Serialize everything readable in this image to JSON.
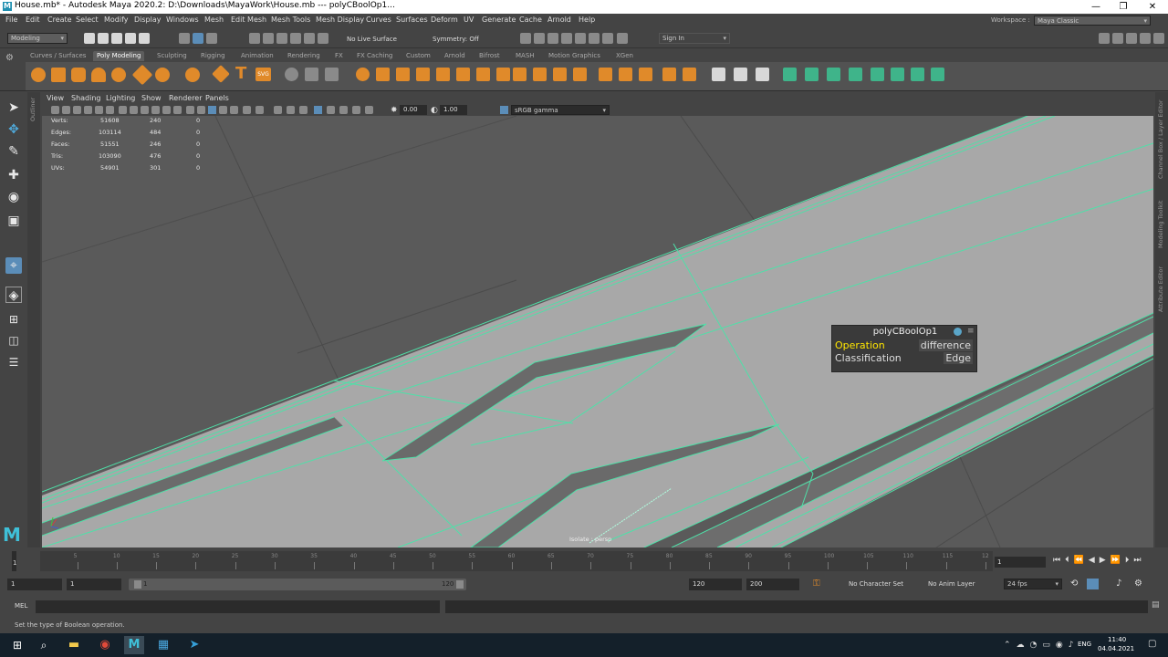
{
  "window": {
    "title": "House.mb* - Autodesk Maya 2020.2: D:\\Downloads\\MayaWork\\House.mb   ---   polyCBoolOp1...",
    "minimize": "—",
    "maximize": "❐",
    "close": "✕"
  },
  "menubar": {
    "items": [
      "File",
      "Edit",
      "Create",
      "Select",
      "Modify",
      "Display",
      "Windows",
      "Mesh",
      "Edit Mesh",
      "Mesh Tools",
      "Mesh Display",
      "Curves",
      "Surfaces",
      "Deform",
      "UV",
      "Generate",
      "Cache",
      "Arnold",
      "Help"
    ],
    "workspace_label": "Workspace :",
    "workspace_value": "Maya Classic"
  },
  "statusline": {
    "menuset": "Modeling",
    "live_surface": "No Live Surface",
    "symmetry": "Symmetry: Off",
    "sign_in": "Sign In"
  },
  "shelf": {
    "tabs": [
      "Curves / Surfaces",
      "Poly Modeling",
      "Sculpting",
      "Rigging",
      "Animation",
      "Rendering",
      "FX",
      "FX Caching",
      "Custom",
      "Arnold",
      "Bifrost",
      "MASH",
      "Motion Graphics",
      "XGen"
    ],
    "active_tab": "Poly Modeling",
    "text_icon": "T",
    "svg_icon_label": "SVG"
  },
  "viewport": {
    "menu": [
      "View",
      "Shading",
      "Lighting",
      "Show",
      "Renderer",
      "Panels"
    ],
    "exposure": "0.00",
    "gamma": "1.00",
    "color_space": "sRGB gamma",
    "camera_label": "Isolate : persp",
    "hud": [
      {
        "label": "Verts:",
        "total": "51608",
        "selected": "240",
        "comp": "0"
      },
      {
        "label": "Edges:",
        "total": "103114",
        "selected": "484",
        "comp": "0"
      },
      {
        "label": "Faces:",
        "total": "51551",
        "selected": "246",
        "comp": "0"
      },
      {
        "label": "Tris:",
        "total": "103090",
        "selected": "476",
        "comp": "0"
      },
      {
        "label": "UVs:",
        "total": "54901",
        "selected": "301",
        "comp": "0"
      }
    ],
    "outliner_tab": "Outliner"
  },
  "bool_popup": {
    "title": "polyCBoolOp1",
    "rows": [
      {
        "label": "Operation",
        "value": "difference",
        "highlight": "#ffe600"
      },
      {
        "label": "Classification",
        "value": "Edge"
      }
    ]
  },
  "right_tabs": [
    "Channel Box / Layer Editor",
    "Modeling Toolkit",
    "Attribute Editor"
  ],
  "timeslider": {
    "ticks": [
      "1",
      "5",
      "10",
      "15",
      "20",
      "25",
      "30",
      "35",
      "40",
      "45",
      "50",
      "55",
      "60",
      "65",
      "70",
      "75",
      "80",
      "85",
      "90",
      "95",
      "100",
      "105",
      "110",
      "115",
      "120"
    ],
    "current_frame": "1"
  },
  "rangeslider": {
    "start": "1",
    "anim_start": "1",
    "range_start": "1",
    "range_end": "120",
    "anim_end": "120",
    "end": "200",
    "character_set": "No Character Set",
    "anim_layer": "No Anim Layer",
    "fps": "24 fps"
  },
  "cmdline": {
    "label": "MEL"
  },
  "helpline": {
    "text": "Set the type of Boolean operation."
  },
  "taskbar": {
    "lang": "ENG",
    "time": "11:40",
    "date": "04.04.2021"
  },
  "colors": {
    "wire": "#4fe0a8",
    "highlight": "#ffe600",
    "accent_orange": "#e08a2a"
  }
}
